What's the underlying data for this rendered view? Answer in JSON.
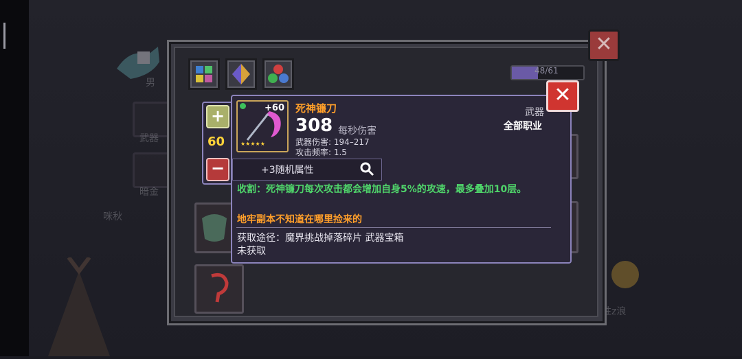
{
  "background": {
    "side_tab_weapon": "武器",
    "side_tab_gold": "暗金",
    "character_name_1": "咪秋",
    "character_suffix_2": "性z浪",
    "other_label": "男"
  },
  "panel": {
    "counter": "48/61",
    "close_icon": "close-icon"
  },
  "item": {
    "name": "死神镰刀",
    "plus": "+60",
    "stars": "★★★★★",
    "dps_value": "308",
    "dps_label": "每秒伤害",
    "damage_line": "武器伤害: 194–217",
    "speed_line": "攻击频率: 1.5",
    "type": "武器",
    "class": "全部职业",
    "random_attr": "+3随机属性",
    "description": "收割：死神镰刀每次攻击都会增加自身5%的攻速，最多叠加10层。",
    "flavor": "地牢副本不知道在哪里捡来的",
    "source": "获取途径：魔界挑战掉落碎片 武器宝箱",
    "obtained": "未获取"
  },
  "level_adjust": {
    "plus": "+",
    "level": "60",
    "minus": "−"
  },
  "colors": {
    "accent_orange": "#ff9f2a",
    "desc_green": "#4fd46a",
    "close_red": "#d03530",
    "tooltip_border": "#8c84bc"
  }
}
